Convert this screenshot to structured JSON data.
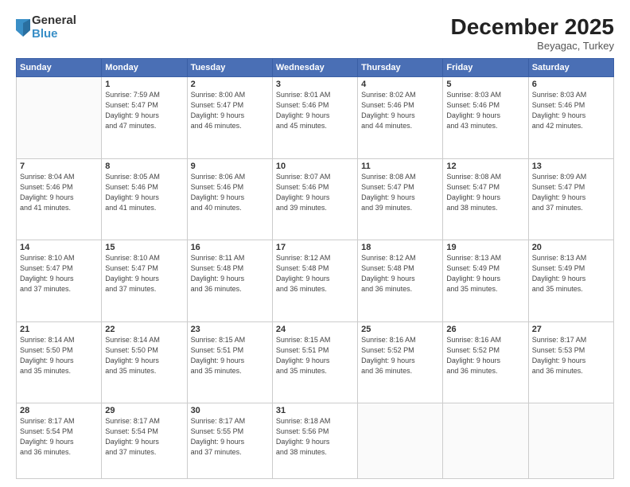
{
  "logo": {
    "line1": "General",
    "line2": "Blue"
  },
  "title": "December 2025",
  "location": "Beyagac, Turkey",
  "weekdays": [
    "Sunday",
    "Monday",
    "Tuesday",
    "Wednesday",
    "Thursday",
    "Friday",
    "Saturday"
  ],
  "weeks": [
    [
      {
        "day": "",
        "info": ""
      },
      {
        "day": "1",
        "info": "Sunrise: 7:59 AM\nSunset: 5:47 PM\nDaylight: 9 hours\nand 47 minutes."
      },
      {
        "day": "2",
        "info": "Sunrise: 8:00 AM\nSunset: 5:47 PM\nDaylight: 9 hours\nand 46 minutes."
      },
      {
        "day": "3",
        "info": "Sunrise: 8:01 AM\nSunset: 5:46 PM\nDaylight: 9 hours\nand 45 minutes."
      },
      {
        "day": "4",
        "info": "Sunrise: 8:02 AM\nSunset: 5:46 PM\nDaylight: 9 hours\nand 44 minutes."
      },
      {
        "day": "5",
        "info": "Sunrise: 8:03 AM\nSunset: 5:46 PM\nDaylight: 9 hours\nand 43 minutes."
      },
      {
        "day": "6",
        "info": "Sunrise: 8:03 AM\nSunset: 5:46 PM\nDaylight: 9 hours\nand 42 minutes."
      }
    ],
    [
      {
        "day": "7",
        "info": "Sunrise: 8:04 AM\nSunset: 5:46 PM\nDaylight: 9 hours\nand 41 minutes."
      },
      {
        "day": "8",
        "info": "Sunrise: 8:05 AM\nSunset: 5:46 PM\nDaylight: 9 hours\nand 41 minutes."
      },
      {
        "day": "9",
        "info": "Sunrise: 8:06 AM\nSunset: 5:46 PM\nDaylight: 9 hours\nand 40 minutes."
      },
      {
        "day": "10",
        "info": "Sunrise: 8:07 AM\nSunset: 5:46 PM\nDaylight: 9 hours\nand 39 minutes."
      },
      {
        "day": "11",
        "info": "Sunrise: 8:08 AM\nSunset: 5:47 PM\nDaylight: 9 hours\nand 39 minutes."
      },
      {
        "day": "12",
        "info": "Sunrise: 8:08 AM\nSunset: 5:47 PM\nDaylight: 9 hours\nand 38 minutes."
      },
      {
        "day": "13",
        "info": "Sunrise: 8:09 AM\nSunset: 5:47 PM\nDaylight: 9 hours\nand 37 minutes."
      }
    ],
    [
      {
        "day": "14",
        "info": "Sunrise: 8:10 AM\nSunset: 5:47 PM\nDaylight: 9 hours\nand 37 minutes."
      },
      {
        "day": "15",
        "info": "Sunrise: 8:10 AM\nSunset: 5:47 PM\nDaylight: 9 hours\nand 37 minutes."
      },
      {
        "day": "16",
        "info": "Sunrise: 8:11 AM\nSunset: 5:48 PM\nDaylight: 9 hours\nand 36 minutes."
      },
      {
        "day": "17",
        "info": "Sunrise: 8:12 AM\nSunset: 5:48 PM\nDaylight: 9 hours\nand 36 minutes."
      },
      {
        "day": "18",
        "info": "Sunrise: 8:12 AM\nSunset: 5:48 PM\nDaylight: 9 hours\nand 36 minutes."
      },
      {
        "day": "19",
        "info": "Sunrise: 8:13 AM\nSunset: 5:49 PM\nDaylight: 9 hours\nand 35 minutes."
      },
      {
        "day": "20",
        "info": "Sunrise: 8:13 AM\nSunset: 5:49 PM\nDaylight: 9 hours\nand 35 minutes."
      }
    ],
    [
      {
        "day": "21",
        "info": "Sunrise: 8:14 AM\nSunset: 5:50 PM\nDaylight: 9 hours\nand 35 minutes."
      },
      {
        "day": "22",
        "info": "Sunrise: 8:14 AM\nSunset: 5:50 PM\nDaylight: 9 hours\nand 35 minutes."
      },
      {
        "day": "23",
        "info": "Sunrise: 8:15 AM\nSunset: 5:51 PM\nDaylight: 9 hours\nand 35 minutes."
      },
      {
        "day": "24",
        "info": "Sunrise: 8:15 AM\nSunset: 5:51 PM\nDaylight: 9 hours\nand 35 minutes."
      },
      {
        "day": "25",
        "info": "Sunrise: 8:16 AM\nSunset: 5:52 PM\nDaylight: 9 hours\nand 36 minutes."
      },
      {
        "day": "26",
        "info": "Sunrise: 8:16 AM\nSunset: 5:52 PM\nDaylight: 9 hours\nand 36 minutes."
      },
      {
        "day": "27",
        "info": "Sunrise: 8:17 AM\nSunset: 5:53 PM\nDaylight: 9 hours\nand 36 minutes."
      }
    ],
    [
      {
        "day": "28",
        "info": "Sunrise: 8:17 AM\nSunset: 5:54 PM\nDaylight: 9 hours\nand 36 minutes."
      },
      {
        "day": "29",
        "info": "Sunrise: 8:17 AM\nSunset: 5:54 PM\nDaylight: 9 hours\nand 37 minutes."
      },
      {
        "day": "30",
        "info": "Sunrise: 8:17 AM\nSunset: 5:55 PM\nDaylight: 9 hours\nand 37 minutes."
      },
      {
        "day": "31",
        "info": "Sunrise: 8:18 AM\nSunset: 5:56 PM\nDaylight: 9 hours\nand 38 minutes."
      },
      {
        "day": "",
        "info": ""
      },
      {
        "day": "",
        "info": ""
      },
      {
        "day": "",
        "info": ""
      }
    ]
  ]
}
